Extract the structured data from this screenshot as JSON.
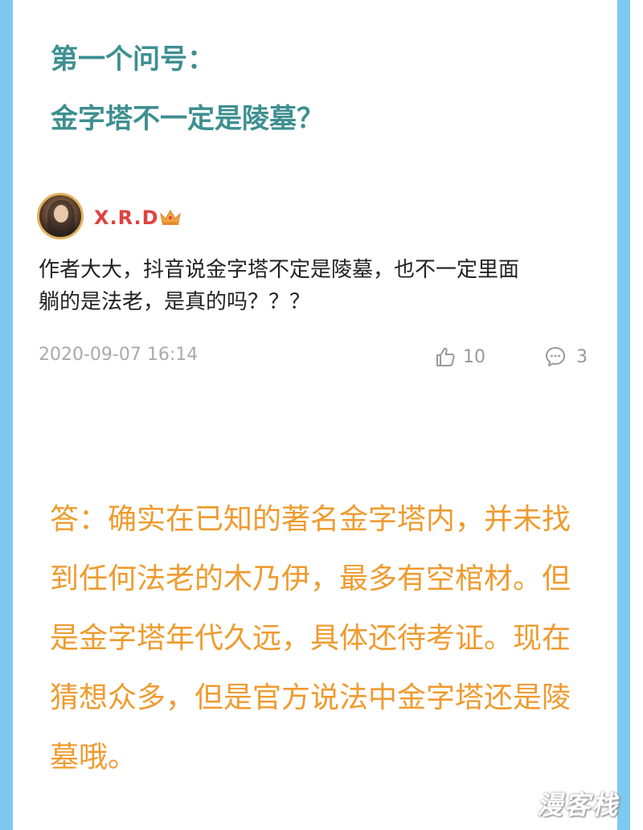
{
  "heading": {
    "line1": "第一个问号：",
    "line2": "金字塔不一定是陵墓？"
  },
  "comment": {
    "username": "X.R.D",
    "badge_icon": "crown-icon",
    "text_lines": [
      "作者大大，抖音说金字塔不定是陵墓，也不一定里面",
      "躺的是法老，是真的吗？？？"
    ],
    "timestamp": "2020-09-07 16:14",
    "likes": "10",
    "replies": "3"
  },
  "answer": {
    "lines": [
      "答：确实在已知的著名金字塔内，并未找",
      "到任何法老的木乃伊，最多有空棺材。但",
      "是金字塔年代久远，具体还待考证。现在",
      "猜想众多，但是官方说法中金字塔还是陵",
      "墓哦。"
    ]
  },
  "watermark": "漫客栈",
  "colors": {
    "border": "#7fc9f0",
    "heading": "#3e8f90",
    "username": "#e0423e",
    "answer": "#ef9b2f"
  }
}
